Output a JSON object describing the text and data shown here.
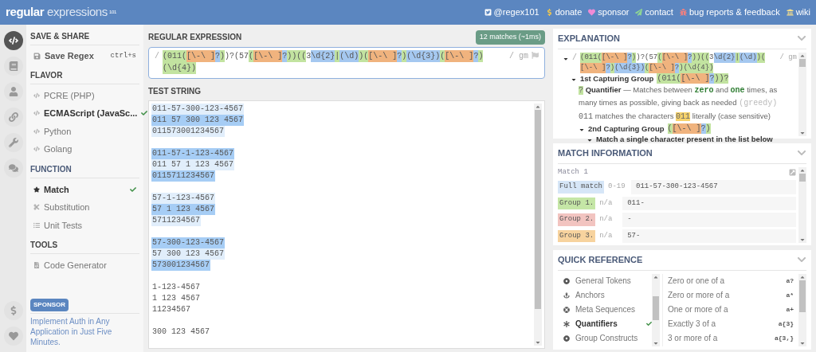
{
  "header": {
    "logo": "regular expressions",
    "logo_sup": "101",
    "links": [
      "@regex101",
      "donate",
      "sponsor",
      "contact",
      "bug reports & feedback",
      "wiki"
    ]
  },
  "rail": [
    {
      "selected": true
    },
    {
      "selected": false
    },
    {
      "selected": false
    },
    {
      "selected": false
    },
    {
      "selected": false
    },
    {
      "selected": false
    },
    {
      "selected": false
    },
    {
      "selected": false
    }
  ],
  "sidebar": {
    "save_title": "SAVE & SHARE",
    "save_label": "Save Regex",
    "save_shortcut": "ctrl+s",
    "flavor_title": "FLAVOR",
    "flavors": [
      {
        "label": "PCRE (PHP)",
        "selected": false
      },
      {
        "label": "ECMAScript (JavaSc...",
        "selected": true
      },
      {
        "label": "Python",
        "selected": false
      },
      {
        "label": "Golang",
        "selected": false
      }
    ],
    "function_title": "FUNCTION",
    "functions": [
      {
        "label": "Match",
        "selected": true
      },
      {
        "label": "Substitution",
        "selected": false
      },
      {
        "label": "Unit Tests",
        "selected": false
      }
    ],
    "tools_title": "TOOLS",
    "tools": [
      "Code Generator"
    ],
    "sponsor_badge": "SPONSOR",
    "sponsor_text": "Implement Auth in Any Application in Just Five Minutes."
  },
  "regex": {
    "title": "REGULAR EXPRESSION",
    "badge": "12 matches (~1ms)",
    "open": "/",
    "close": "/ gm",
    "tokens": [
      {
        "text": "(011",
        "kind": "group"
      },
      {
        "text": "(",
        "kind": "group"
      },
      {
        "text": "[\\-\\ ]",
        "kind": "class"
      },
      {
        "text": "?",
        "kind": "quant"
      },
      {
        "text": ")",
        "kind": "group"
      },
      {
        "text": ")?(57",
        "kind": "plain"
      },
      {
        "text": "(",
        "kind": "group"
      },
      {
        "text": "[\\-\\ ]",
        "kind": "class"
      },
      {
        "text": "?",
        "kind": "quant"
      },
      {
        "text": "))",
        "kind": "group"
      },
      {
        "text": "((",
        "kind": "group"
      },
      {
        "text": "3",
        "kind": "plain"
      },
      {
        "text": "\\d{2}",
        "kind": "quant"
      },
      {
        "text": "|",
        "kind": "group"
      },
      {
        "text": "(\\d)",
        "kind": "quant"
      },
      {
        "text": ")",
        "kind": "group"
      },
      {
        "text": "(",
        "kind": "group"
      },
      {
        "text": "[\\-\\ ]",
        "kind": "class"
      },
      {
        "text": "?",
        "kind": "quant"
      },
      {
        "text": ")",
        "kind": "group"
      },
      {
        "text": "(\\d{3})",
        "kind": "quant"
      },
      {
        "text": "(",
        "kind": "group"
      },
      {
        "text": "[\\-\\ ]",
        "kind": "class"
      },
      {
        "text": "?",
        "kind": "quant"
      },
      {
        "text": ")",
        "kind": "group"
      },
      {
        "text": "(\\d{4})",
        "kind": "group"
      }
    ]
  },
  "test_string": {
    "title": "TEST STRING",
    "blocks": [
      [
        {
          "text": "011-57-300-123-4567",
          "kind": "light"
        },
        {
          "text": "011 57 300 123 4567",
          "kind": "strong"
        },
        {
          "text": "011573001234567",
          "kind": "light"
        }
      ],
      [
        {
          "text": "011-57-1-123-4567",
          "kind": "strong"
        },
        {
          "text": "011 57 1 123 4567",
          "kind": "light"
        },
        {
          "text": "0115711234567",
          "kind": "strong"
        }
      ],
      [
        {
          "text": "57-1-123-4567",
          "kind": "light"
        },
        {
          "text": "57 1 123 4567",
          "kind": "strong"
        },
        {
          "text": "5711234567",
          "kind": "light"
        }
      ],
      [
        {
          "text": "57-300-123-4567",
          "kind": "strong"
        },
        {
          "text": "57 300 123 4567",
          "kind": "light"
        },
        {
          "text": "573001234567",
          "kind": "strong"
        }
      ],
      [
        {
          "text": "1-123-4567",
          "kind": "none"
        },
        {
          "text": "1 123 4567",
          "kind": "none"
        },
        {
          "text": "11234567",
          "kind": "none"
        }
      ],
      [
        {
          "text": "300 123 4567",
          "kind": "none"
        }
      ]
    ]
  },
  "explanation": {
    "title": "EXPLANATION",
    "root": {
      "open": "/",
      "close": "/ gm",
      "tokens": [
        {
          "text": "(011",
          "kind": "group"
        },
        {
          "text": "(",
          "kind": "group"
        },
        {
          "text": "[\\-\\ ]",
          "kind": "class"
        },
        {
          "text": "?",
          "kind": "quant"
        },
        {
          "text": ")",
          "kind": "group"
        },
        {
          "text": ")?(57",
          "kind": "plain"
        },
        {
          "text": "(",
          "kind": "group"
        },
        {
          "text": "[\\-\\ ]",
          "kind": "class"
        },
        {
          "text": "?",
          "kind": "quant"
        },
        {
          "text": "))",
          "kind": "group"
        },
        {
          "text": "((",
          "kind": "group"
        },
        {
          "text": "3",
          "kind": "plain"
        },
        {
          "text": "\\d{2}",
          "kind": "quant"
        },
        {
          "text": "|",
          "kind": "group"
        },
        {
          "text": "(\\d)",
          "kind": "quant"
        },
        {
          "text": ")",
          "kind": "group"
        },
        {
          "text": "(",
          "kind": "group"
        },
        {
          "text": "[\\-\\ ]",
          "kind": "class"
        },
        {
          "text": "?",
          "kind": "quant"
        },
        {
          "text": ")",
          "kind": "group"
        },
        {
          "text": "(\\d{3})",
          "kind": "quant"
        },
        {
          "text": "(",
          "kind": "group"
        },
        {
          "text": "[\\-\\ ]",
          "kind": "class"
        },
        {
          "text": "?",
          "kind": "quant"
        },
        {
          "text": ")",
          "kind": "group"
        },
        {
          "text": "(\\d{4})",
          "kind": "group"
        }
      ],
      "children": [
        {
          "kind": "group",
          "label": "1st Capturing Group",
          "tokens": [
            {
              "text": "(011",
              "kind": "group"
            },
            {
              "text": "(",
              "kind": "group"
            },
            {
              "text": "[\\-\\ ]",
              "kind": "class"
            },
            {
              "text": "?",
              "kind": "quant"
            },
            {
              "text": "))?",
              "kind": "group"
            }
          ],
          "children": [
            {
              "kind": "quantifier",
              "token": "?",
              "label": "Quantifier",
              "text": "— Matches between",
              "min": "zero",
              "mid": "and",
              "max": "one",
              "rest": "times, as many times as possible, giving back as needed",
              "mode": "(greedy)"
            },
            {
              "kind": "literal",
              "chars": "011",
              "text": "matches the characters",
              "hl": "011",
              "rest": "literally (case sensitive)"
            },
            {
              "kind": "group",
              "label": "2nd Capturing Group",
              "tokens": [
                {
                  "text": "(",
                  "kind": "group"
                },
                {
                  "text": "[\\-\\ ]",
                  "kind": "class"
                },
                {
                  "text": "?",
                  "kind": "quant"
                },
                {
                  "text": ")",
                  "kind": "group"
                }
              ],
              "children": [
                {
                  "kind": "class",
                  "label": "Match a single character present in the list below"
                }
              ]
            }
          ]
        }
      ]
    }
  },
  "match_info": {
    "title": "MATCH INFORMATION",
    "match_label": "Match 1",
    "rows": [
      {
        "label": "Full match",
        "color": "#d6e6f7",
        "range": "0-19",
        "value": "011-57-300-123-4567"
      },
      {
        "label": "Group 1.",
        "color": "#c5e6a6",
        "range": "n/a",
        "value": "011-"
      },
      {
        "label": "Group 2.",
        "color": "#f2c4c0",
        "range": "n/a",
        "value": "-"
      },
      {
        "label": "Group 3.",
        "color": "#f7d39e",
        "range": "n/a",
        "value": "57-"
      }
    ]
  },
  "quick_reference": {
    "title": "QUICK REFERENCE",
    "categories": [
      {
        "label": "General Tokens",
        "selected": false
      },
      {
        "label": "Anchors",
        "selected": false
      },
      {
        "label": "Meta Sequences",
        "selected": false
      },
      {
        "label": "Quantifiers",
        "selected": true
      },
      {
        "label": "Group Constructs",
        "selected": false
      }
    ],
    "items": [
      {
        "desc": "Zero or one of a",
        "token": "a?"
      },
      {
        "desc": "Zero or more of a",
        "token": "a*"
      },
      {
        "desc": "One or more of a",
        "token": "a+"
      },
      {
        "desc": "Exactly 3 of a",
        "token": "a{3}"
      },
      {
        "desc": "3 or more of a",
        "token": "a{3,}"
      }
    ]
  }
}
